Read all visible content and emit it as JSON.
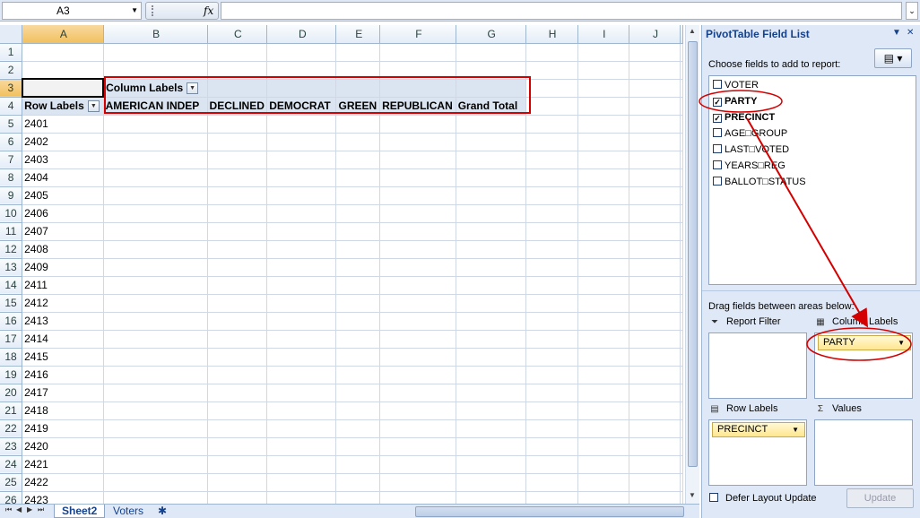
{
  "formula_bar": {
    "name_box": "A3",
    "fx": "fx",
    "formula": ""
  },
  "grid": {
    "columns": [
      "A",
      "B",
      "C",
      "D",
      "E",
      "F",
      "G",
      "H",
      "I",
      "J"
    ],
    "rows": [
      "1",
      "2",
      "3",
      "4",
      "5",
      "6",
      "7",
      "8",
      "9",
      "10",
      "11",
      "12",
      "13",
      "14",
      "15",
      "16",
      "17",
      "18",
      "19",
      "20",
      "21",
      "22",
      "23",
      "24",
      "25",
      "26"
    ],
    "column_labels": "Column Labels",
    "row_labels": "Row Labels",
    "party_headers": [
      "AMERICAN INDEP",
      "DECLINED",
      "DEMOCRAT",
      "GREEN",
      "REPUBLICAN",
      "Grand Total"
    ],
    "precincts": [
      "2401",
      "2402",
      "2403",
      "2404",
      "2405",
      "2406",
      "2407",
      "2408",
      "2409",
      "2411",
      "2412",
      "2413",
      "2414",
      "2415",
      "2416",
      "2417",
      "2418",
      "2419",
      "2420",
      "2421",
      "2422",
      "2423"
    ]
  },
  "sheets": {
    "tabs": [
      "Sheet2",
      "Voters"
    ],
    "active": "Sheet2"
  },
  "pivot_pane": {
    "title": "PivotTable Field List",
    "choose_label": "Choose fields to add to report:",
    "fields": [
      {
        "name": "VOTER",
        "checked": false
      },
      {
        "name": "PARTY",
        "checked": true
      },
      {
        "name": "PRECINCT",
        "checked": true
      },
      {
        "name": "AGE□GROUP",
        "checked": false
      },
      {
        "name": "LAST□VOTED",
        "checked": false
      },
      {
        "name": "YEARS□REG",
        "checked": false
      },
      {
        "name": "BALLOT□STATUS",
        "checked": false
      }
    ],
    "drag_label": "Drag fields between areas below:",
    "areas": {
      "report_filter": "Report Filter",
      "column_labels": "Column Labels",
      "row_labels": "Row Labels",
      "values": "Values"
    },
    "column_field": "PARTY",
    "row_field": "PRECINCT",
    "defer_label": "Defer Layout Update",
    "update_label": "Update"
  },
  "colors": {
    "accent_red": "#d40000",
    "pane_bg": "#dfe8f6",
    "header_blue": "#15428b"
  }
}
